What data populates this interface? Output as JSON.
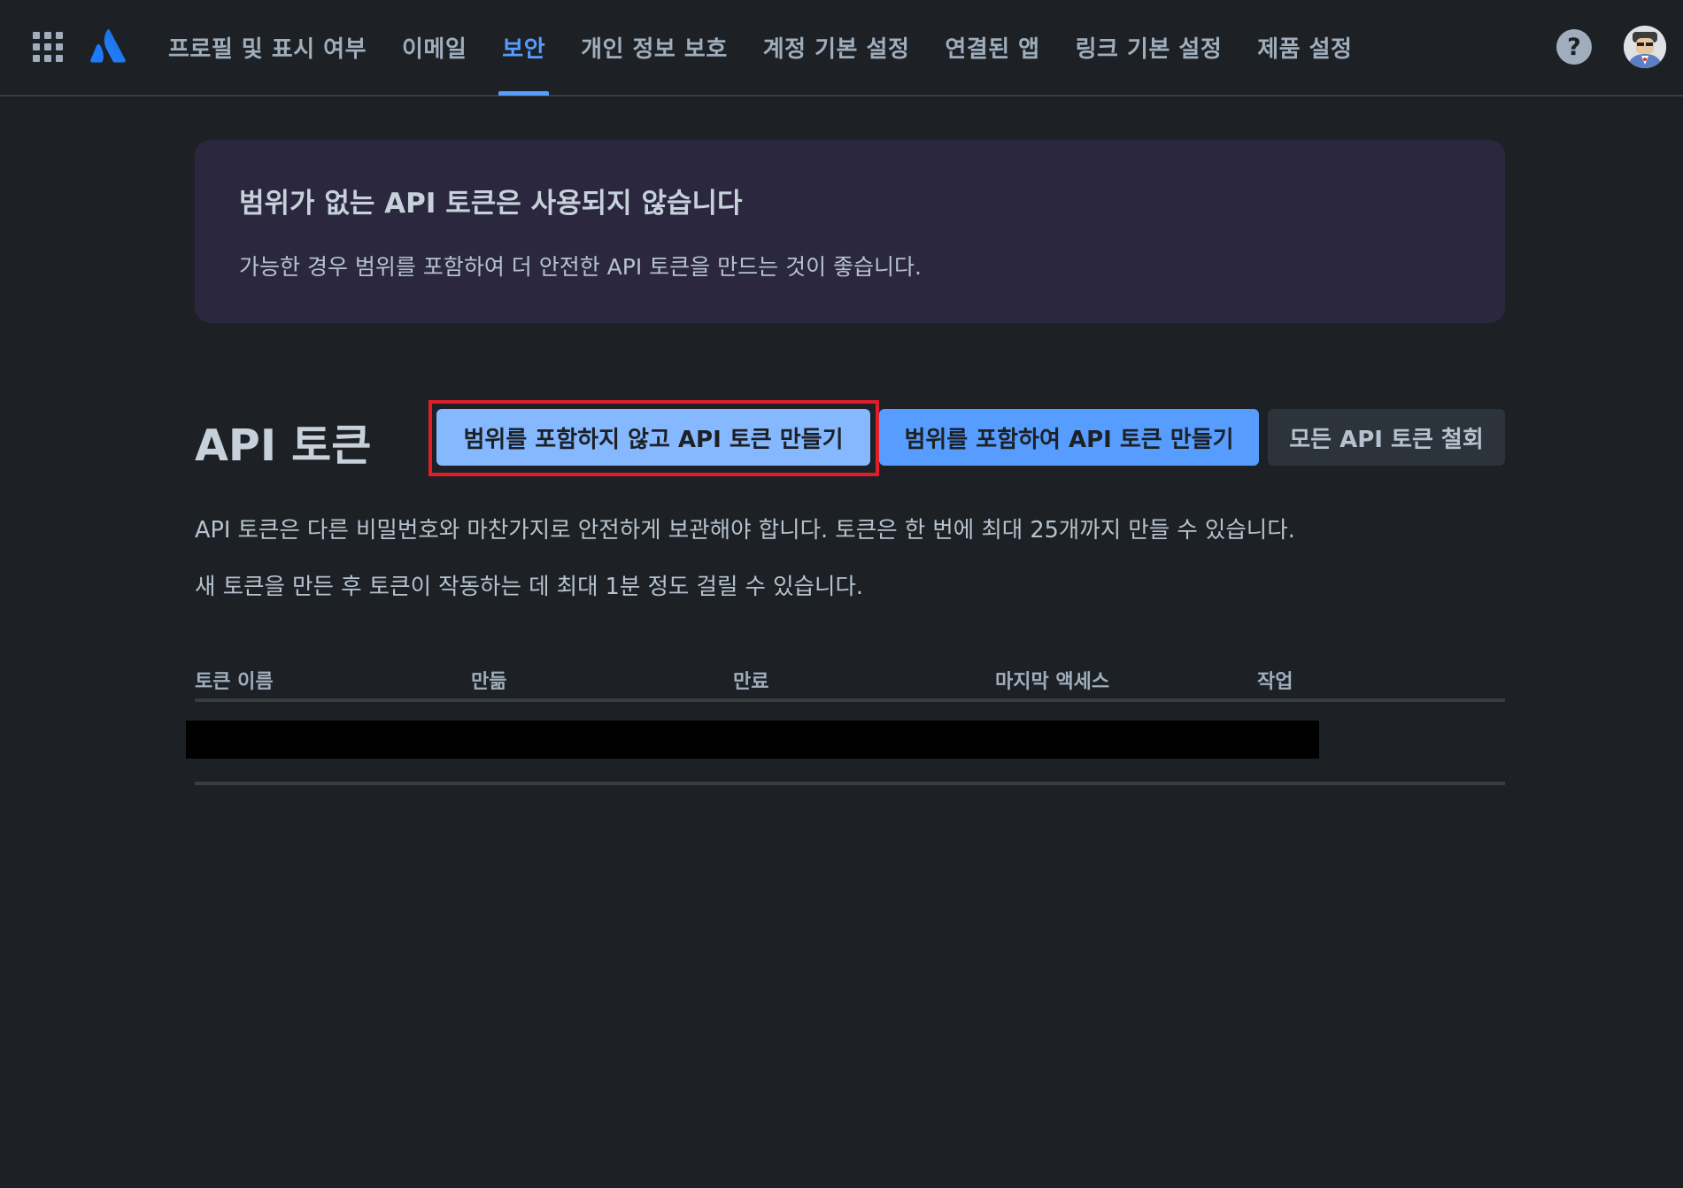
{
  "nav": {
    "apps_icon": "app-grid-icon",
    "logo_icon": "atlassian-logo-icon",
    "tabs": [
      {
        "label": "프로필 및 표시 여부",
        "active": false
      },
      {
        "label": "이메일",
        "active": false
      },
      {
        "label": "보안",
        "active": true
      },
      {
        "label": "개인 정보 보호",
        "active": false
      },
      {
        "label": "계정 기본 설정",
        "active": false
      },
      {
        "label": "연결된 앱",
        "active": false
      },
      {
        "label": "링크 기본 설정",
        "active": false
      },
      {
        "label": "제품 설정",
        "active": false
      }
    ],
    "help_glyph": "?"
  },
  "banner": {
    "title": "범위가 없는 API 토큰은 사용되지 않습니다",
    "text": "가능한 경우 범위를 포함하여 더 안전한 API 토큰을 만드는 것이 좋습니다."
  },
  "api_tokens": {
    "title": "API 토큰",
    "create_without_scope_label": "범위를 포함하지 않고 API 토큰 만들기",
    "create_with_scope_label": "범위를 포함하여 API 토큰 만들기",
    "revoke_all_label": "모든 API 토큰 철회",
    "description_1": "API 토큰은 다른 비밀번호와 마찬가지로 안전하게 보관해야 합니다. 토큰은 한 번에 최대 25개까지 만들 수 있습니다.",
    "description_2": "새 토큰을 만든 후 토큰이 작동하는 데 최대 1분 정도 걸릴 수 있습니다.",
    "table": {
      "headers": {
        "name": "토큰 이름",
        "created": "만듦",
        "expires": "만료",
        "last_accessed": "마지막 액세스",
        "actions": "작업"
      }
    }
  },
  "colors": {
    "background": "#1d2125",
    "accent": "#579dff",
    "accent_light": "#85b8ff",
    "banner": "#2b273f",
    "highlight": "#e01e2a"
  }
}
